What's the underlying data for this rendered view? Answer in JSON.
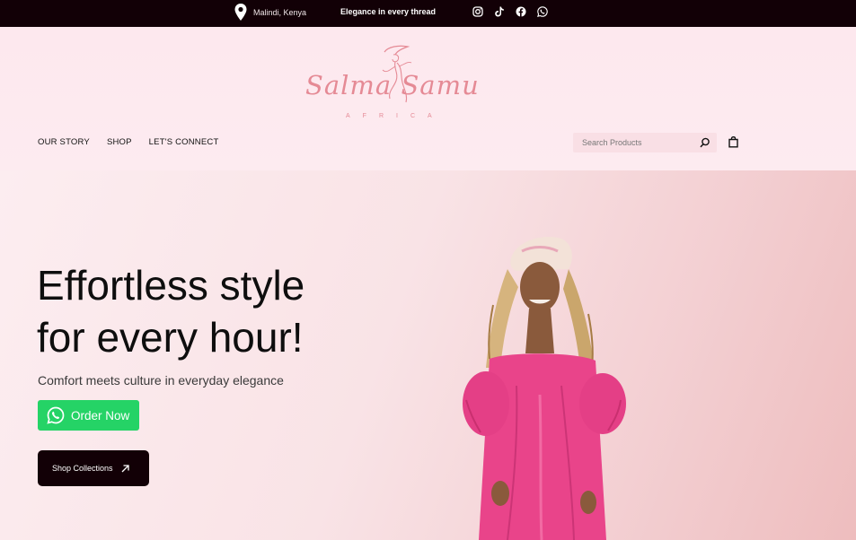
{
  "topbar": {
    "location": "Malindi, Kenya",
    "tagline": "Elegance in every thread",
    "socials": [
      "instagram-icon",
      "tiktok-icon",
      "facebook-icon",
      "whatsapp-icon"
    ]
  },
  "logo": {
    "name": "Salma Samu",
    "sub": "AFRICA"
  },
  "nav": {
    "items": [
      {
        "label": "OUR STORY"
      },
      {
        "label": "SHOP"
      },
      {
        "label": "LET'S CONNECT"
      }
    ]
  },
  "search": {
    "placeholder": "Search Products",
    "value": ""
  },
  "hero": {
    "headline_line1": "Effortless style",
    "headline_line2": "for every hour!",
    "subhead": "Comfort meets culture in everyday elegance",
    "order_label": "Order Now",
    "shop_label": "Shop Collections"
  },
  "colors": {
    "topbar_bg": "#120006",
    "brand_pink": "#e58a95",
    "whatsapp_green": "#25d366",
    "dress_pink": "#e9448a"
  }
}
